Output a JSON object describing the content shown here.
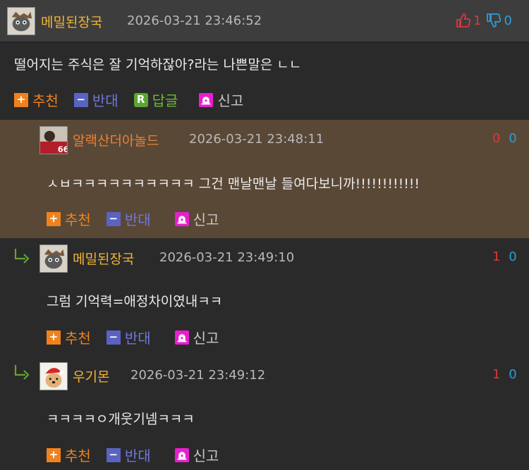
{
  "comments": [
    {
      "nick": "메밀된장국",
      "date": "2026-03-21 23:46:52",
      "up": "1",
      "down": "0",
      "text": "떨어지는 주식은 잘 기억하잖아?라는 나쁜말은 ㄴㄴ",
      "avatar": "cat-avatar-icon"
    },
    {
      "nick": "알랙산더아놀드",
      "date": "2026-03-21 23:48:11",
      "up": "0",
      "down": "0",
      "text": "ㅅㅂㅋㅋㅋㅋㅋㅋㅋㅋㅋㅋ 그건 맨날맨날 들여다보니까!!!!!!!!!!!!",
      "avatar": "football-player-avatar-icon"
    },
    {
      "nick": "메밀된장국",
      "date": "2026-03-21 23:49:10",
      "up": "1",
      "down": "0",
      "text": "그럼 기억력=애정차이였내ㅋㅋ",
      "avatar": "cat-avatar-icon"
    },
    {
      "nick": "우기몬",
      "date": "2026-03-21 23:49:12",
      "up": "1",
      "down": "0",
      "text": "ㅋㅋㅋㅋㅇ개웃기넴ㅋㅋㅋ",
      "avatar": "dog-santa-avatar-icon"
    }
  ],
  "actions": {
    "recommend": "추천",
    "oppose": "반대",
    "reply": "답글",
    "report": "신고"
  },
  "colors": {
    "nick": "#f2b533",
    "nick_alt": "#e8823a",
    "upvote": "#d9383a",
    "downvote": "#2f9bd8",
    "highlight_bg": "#5a4836"
  }
}
